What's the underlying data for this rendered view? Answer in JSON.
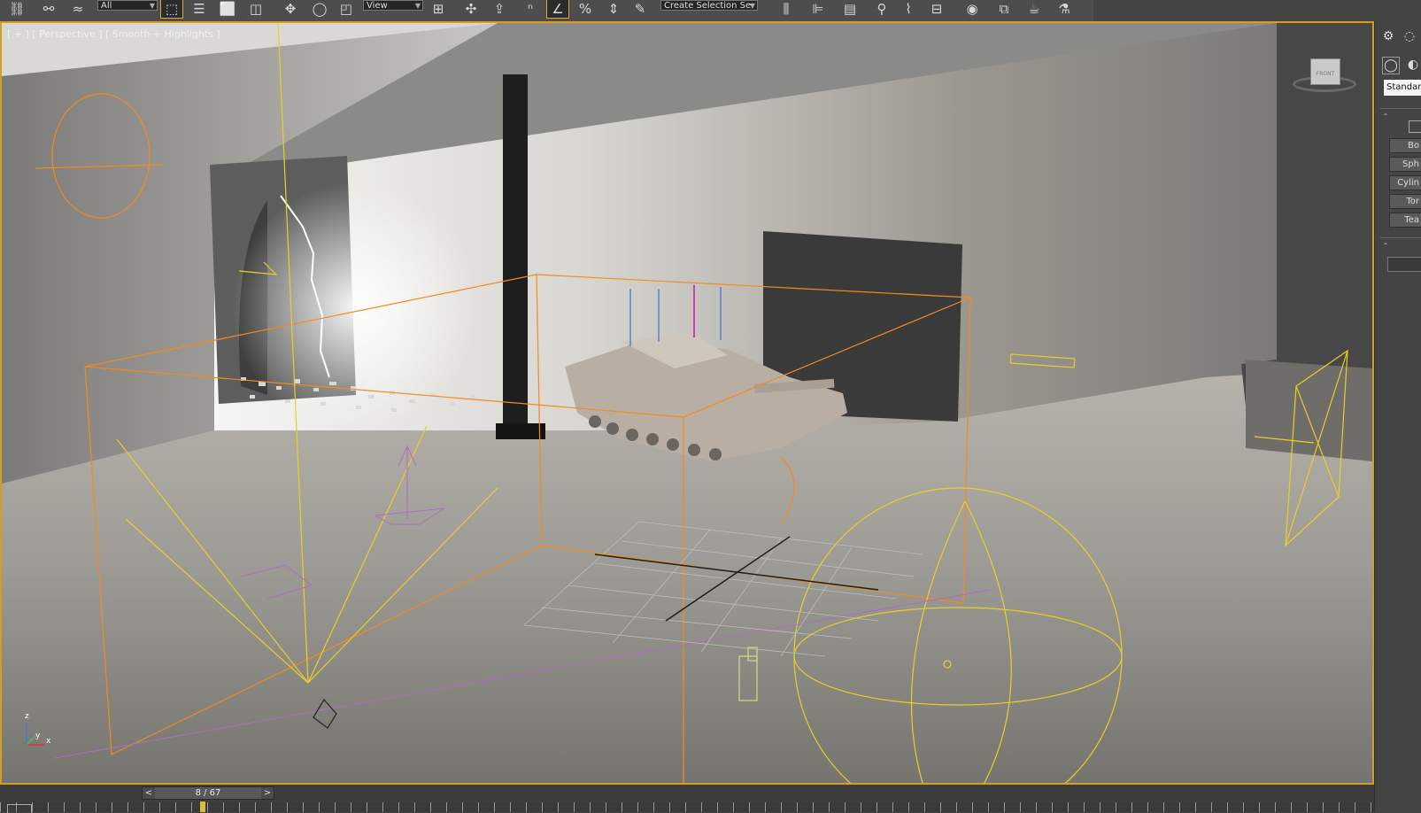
{
  "toolbar": {
    "selection_filter": "All",
    "reference_coord": "View",
    "named_selection": "Create Selection Se"
  },
  "viewport": {
    "label": "[ + ] [ Perspective ] [ Smooth + Highlights ]",
    "viewcube_label": "FRONT",
    "axis_z": "z",
    "axis_y": "y",
    "axis_x": "x"
  },
  "command_panel": {
    "dropdown_value": "Standar",
    "rollout1_toggle": "-",
    "rollout2_toggle": "-",
    "buttons": [
      "Bo",
      "Sph",
      "Cylin",
      "Tor",
      "Tea"
    ]
  },
  "timeline": {
    "frame": "8 / 67",
    "prev": "<",
    "next": ">"
  },
  "colors": {
    "accent": "#d29e2a",
    "selection": "#f28b1c",
    "helper": "#e8d024",
    "particle": "#b06cc0"
  }
}
